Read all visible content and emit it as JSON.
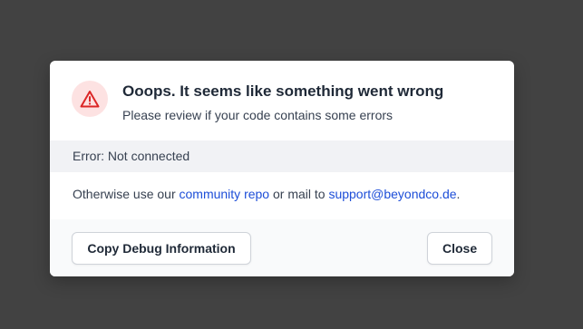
{
  "dialog": {
    "icon": "warning-triangle-icon",
    "title": "Ooops. It seems like something went wrong",
    "subtitle": "Please review if your code contains some errors",
    "error_text": "Error: Not connected",
    "info": {
      "prefix": "Otherwise use our ",
      "link_repo": "community repo",
      "middle": " or mail to ",
      "link_email": "support@beyondco.de",
      "suffix": "."
    },
    "buttons": {
      "copy_debug": "Copy Debug Information",
      "close": "Close"
    }
  },
  "colors": {
    "backdrop": "#424242",
    "icon_bg": "#fde2e2",
    "icon_stroke": "#dc2626",
    "link": "#1d4ed8"
  }
}
